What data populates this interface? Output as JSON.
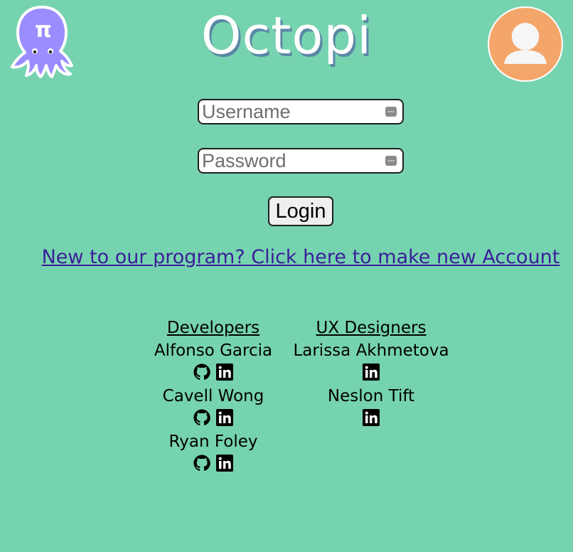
{
  "header": {
    "title": "Octopi",
    "logo_icon": "octopus-pi-logo-icon",
    "logo_text": "π",
    "avatar_icon": "user-avatar-icon"
  },
  "login_form": {
    "username_placeholder": "Username",
    "password_placeholder": "Password",
    "login_label": "Login",
    "signup_link": "New to our program? Click here to make new Account"
  },
  "teams": {
    "developers": {
      "heading": "Developers",
      "members": [
        {
          "name": "Alfonso Garcia",
          "icons": [
            "github-icon",
            "linkedin-icon"
          ]
        },
        {
          "name": "Cavell Wong",
          "icons": [
            "github-icon",
            "linkedin-icon"
          ]
        },
        {
          "name": "Ryan Foley",
          "icons": [
            "github-icon",
            "linkedin-icon"
          ]
        }
      ]
    },
    "ux": {
      "heading": "UX Designers",
      "members": [
        {
          "name": "Larissa Akhmetova",
          "icons": [
            "linkedin-icon"
          ]
        },
        {
          "name": "Neslon Tift",
          "icons": [
            "linkedin-icon"
          ]
        }
      ]
    }
  },
  "colors": {
    "background": "#76d3af",
    "title": "#ffffff",
    "title_shadow": "#5a87a6",
    "avatar": "#f4a66a",
    "logo": "#9b8cff",
    "link": "#3a1e9a"
  }
}
